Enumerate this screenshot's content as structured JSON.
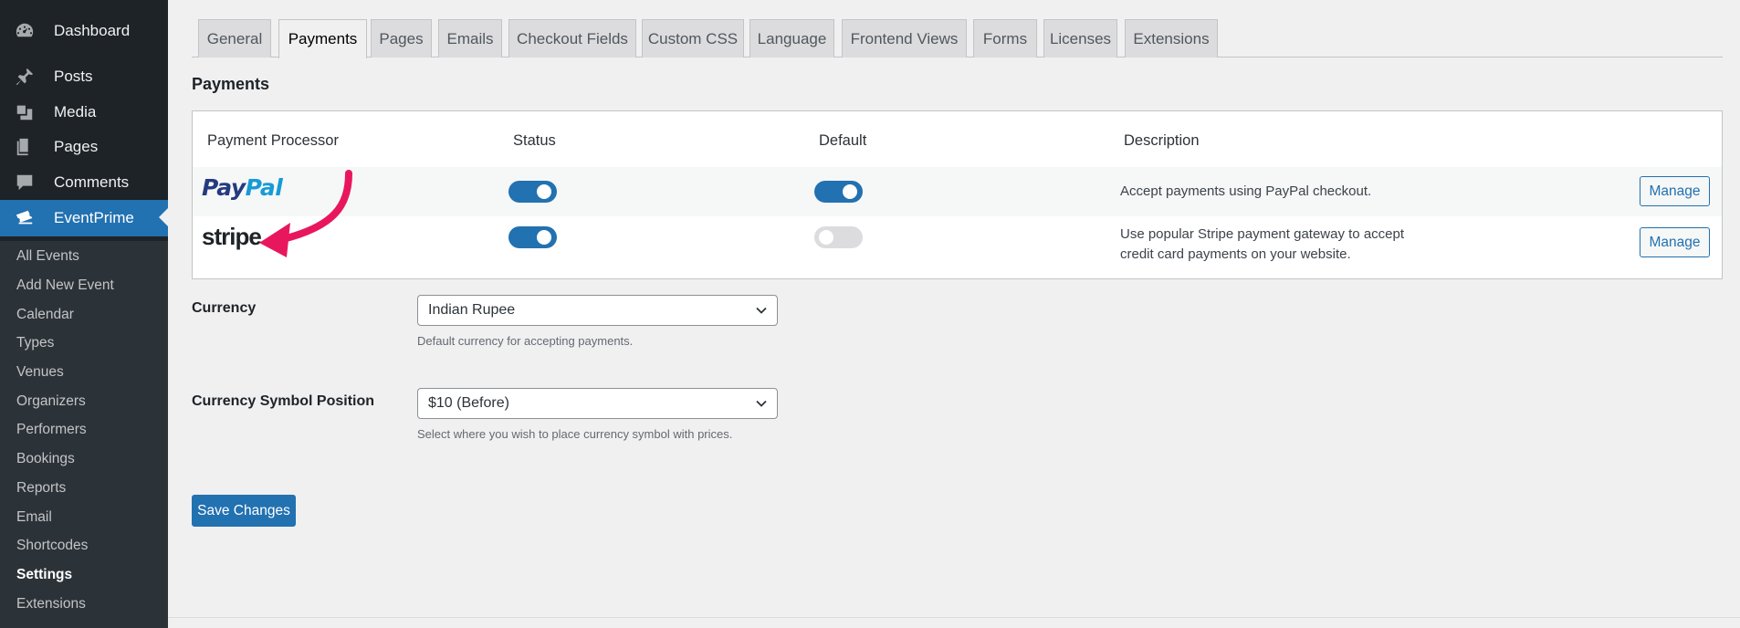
{
  "sidebar": {
    "top_items": [
      {
        "label": "Dashboard",
        "icon": "dashboard-icon"
      },
      {
        "label": "Posts",
        "icon": "pushpin-icon"
      },
      {
        "label": "Media",
        "icon": "media-icon"
      },
      {
        "label": "Pages",
        "icon": "pages-icon"
      },
      {
        "label": "Comments",
        "icon": "comment-icon"
      },
      {
        "label": "EventPrime",
        "icon": "ticket-icon",
        "active": true
      }
    ],
    "sub_items": [
      {
        "label": "All Events"
      },
      {
        "label": "Add New Event"
      },
      {
        "label": "Calendar"
      },
      {
        "label": "Types"
      },
      {
        "label": "Venues"
      },
      {
        "label": "Organizers"
      },
      {
        "label": "Performers"
      },
      {
        "label": "Bookings"
      },
      {
        "label": "Reports"
      },
      {
        "label": "Email"
      },
      {
        "label": "Shortcodes"
      },
      {
        "label": "Settings",
        "current": true
      },
      {
        "label": "Extensions"
      }
    ]
  },
  "tabs": [
    {
      "label": "General"
    },
    {
      "label": "Payments",
      "active": true
    },
    {
      "label": "Pages"
    },
    {
      "label": "Emails"
    },
    {
      "label": "Checkout Fields"
    },
    {
      "label": "Custom CSS"
    },
    {
      "label": "Language"
    },
    {
      "label": "Frontend Views"
    },
    {
      "label": "Forms"
    },
    {
      "label": "Licenses"
    },
    {
      "label": "Extensions"
    }
  ],
  "page_title": "Payments",
  "table": {
    "headers": {
      "processor": "Payment Processor",
      "status": "Status",
      "default": "Default",
      "description": "Description"
    },
    "rows": [
      {
        "processor": "PayPal",
        "logo_parts": [
          "Pay",
          "Pal"
        ],
        "status_on": true,
        "default_on": true,
        "description_lines": [
          "Accept payments using PayPal checkout."
        ],
        "action": "Manage"
      },
      {
        "processor": "stripe",
        "status_on": true,
        "default_on": false,
        "description_lines": [
          "Use popular Stripe payment gateway to accept",
          "credit card payments on your website."
        ],
        "action": "Manage"
      }
    ]
  },
  "currency": {
    "label": "Currency",
    "selected": "Indian Rupee",
    "help": "Default currency for accepting payments."
  },
  "symbol_position": {
    "label": "Currency Symbol Position",
    "selected": "$10 (Before)",
    "help": "Select where you wish to place currency symbol with prices."
  },
  "save_label": "Save Changes",
  "colors": {
    "sidebar_bg": "#1d2327",
    "submenu_bg": "#2c3338",
    "accent": "#2271b1",
    "annotation_arrow": "#e8175d",
    "paypal_dark": "#253b80",
    "paypal_light": "#179bd7"
  }
}
